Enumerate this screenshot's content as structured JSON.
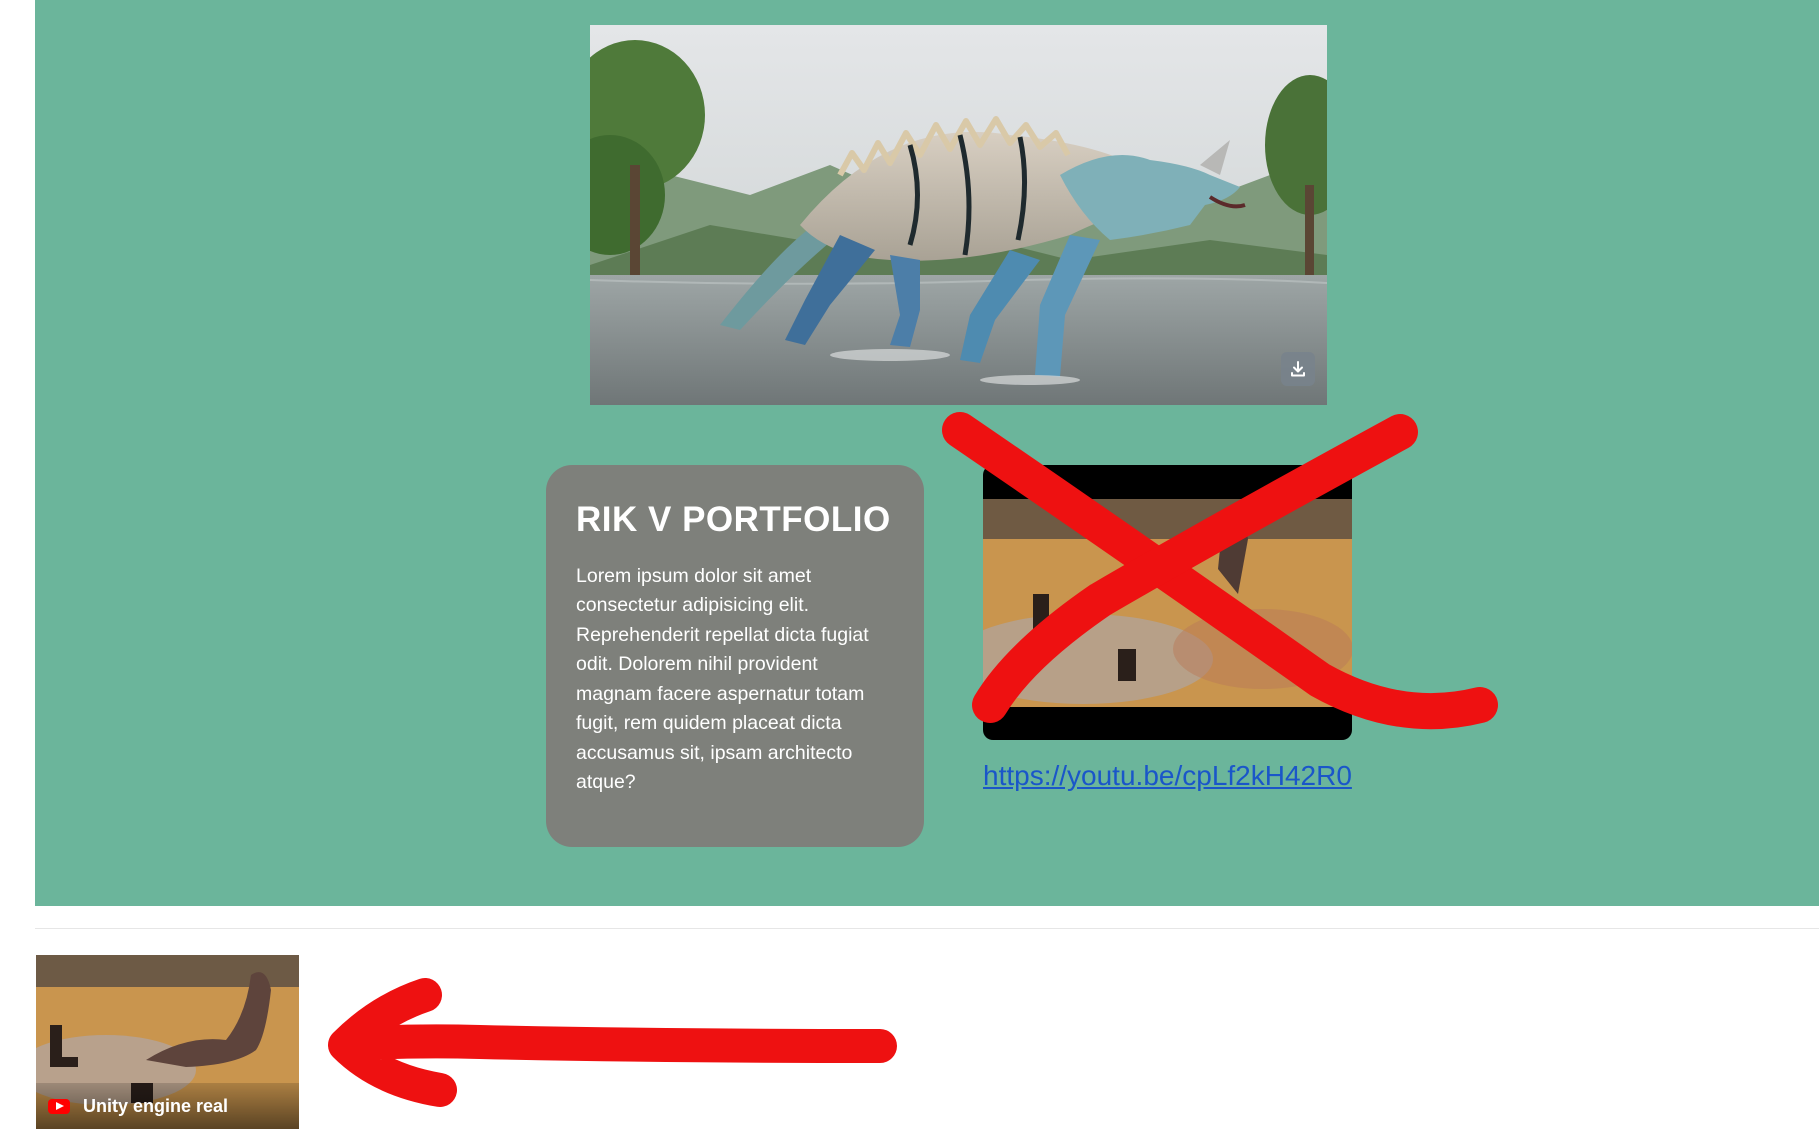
{
  "hero": {
    "background": "#6bb59b",
    "image_description_icon": "dinosaur-image",
    "download_icon": "download-icon"
  },
  "card": {
    "title": "RIK V PORTFOLIO",
    "body": "Lorem ipsum dolor sit amet consectetur adipisicing elit. Reprehenderit repellat dicta fugiat odit. Dolorem nihil provident magnam facere aspernatur totam fugit, rem quidem placeat dicta accusamus sit, ipsam architecto atque?",
    "background": "#7e807b"
  },
  "video": {
    "link_text": "https://youtu.be/cpLf2kH42R0",
    "link_color": "#1a56c9"
  },
  "mini_thumbnail": {
    "title": "Unity engine real",
    "icon": "youtube-icon"
  },
  "annotations": {
    "color": "#ee1111",
    "cross_icon": "red-cross-mark",
    "arrow_icon": "red-arrow-left"
  }
}
